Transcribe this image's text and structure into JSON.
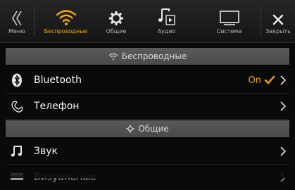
{
  "topbar": {
    "menu_label": "Меню",
    "tabs": [
      {
        "label": "Беспроводные",
        "icon": "wifi-icon",
        "active": true
      },
      {
        "label": "Общие",
        "icon": "gear-icon",
        "active": false
      },
      {
        "label": "Аудио",
        "icon": "music-note-icon",
        "active": false
      },
      {
        "label": "Система",
        "icon": "monitor-icon",
        "active": false
      }
    ],
    "close_label": "Закрыть"
  },
  "sections": [
    {
      "title": "Беспроводные",
      "icon": "wifi-icon"
    },
    {
      "title": "Общие",
      "icon": "gear-icon"
    }
  ],
  "rows": [
    {
      "label": "Bluetooth",
      "value": "On",
      "icon": "bluetooth-icon"
    },
    {
      "label": "Телефон",
      "value": "",
      "icon": "phone-icon"
    },
    {
      "label": "Звук",
      "value": "",
      "icon": "music-note-icon"
    },
    {
      "label": "Визуальные",
      "value": "",
      "icon": "display-icon"
    }
  ],
  "colors": {
    "accent": "#f2a900",
    "background": "#0a0a0a",
    "section": "#505050"
  }
}
